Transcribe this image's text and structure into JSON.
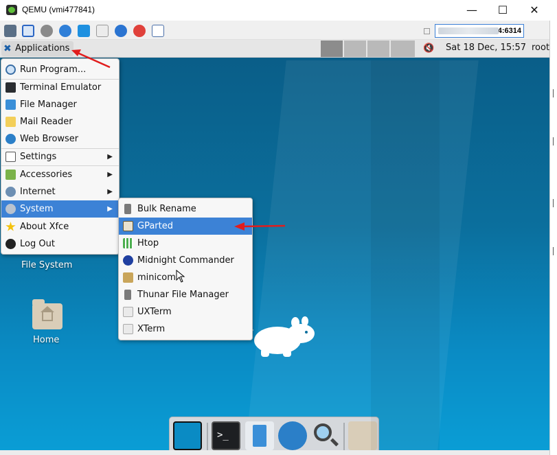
{
  "window": {
    "title": "QEMU (vmi477841)",
    "minimize": "—",
    "maximize": "☐",
    "close": "✕"
  },
  "toolbar": {
    "icons": [
      "settings-icon",
      "fullscreen-icon",
      "gear-icon",
      "refresh-icon",
      "windows-icon",
      "keyboard-icon",
      "info-icon",
      "close-icon",
      "screenshot-icon"
    ],
    "address_suffix": "4:6314"
  },
  "panel": {
    "applications_label": "Applications",
    "clock": "Sat 18 Dec, 15:57",
    "user": "root",
    "volume_icon": "speaker-muted-icon"
  },
  "menu": {
    "items": [
      {
        "label": "Run Program...",
        "icon": "search-icon"
      },
      {
        "label": "Terminal Emulator",
        "icon": "terminal-icon"
      },
      {
        "label": "File Manager",
        "icon": "file-manager-icon"
      },
      {
        "label": "Mail Reader",
        "icon": "mail-icon"
      },
      {
        "label": "Web Browser",
        "icon": "globe-icon"
      },
      {
        "label": "Settings",
        "icon": "settings-icon",
        "submenu": true
      },
      {
        "label": "Accessories",
        "icon": "accessories-icon",
        "submenu": true
      },
      {
        "label": "Internet",
        "icon": "globe-icon",
        "submenu": true
      },
      {
        "label": "System",
        "icon": "gear-icon",
        "submenu": true,
        "highlighted": true
      },
      {
        "label": "About Xfce",
        "icon": "star-icon"
      },
      {
        "label": "Log Out",
        "icon": "logout-icon"
      }
    ]
  },
  "submenu": {
    "items": [
      {
        "label": "Bulk Rename",
        "icon": "hammer-icon"
      },
      {
        "label": "GParted",
        "icon": "gparted-icon",
        "highlighted": true
      },
      {
        "label": "Htop",
        "icon": "htop-icon"
      },
      {
        "label": "Midnight Commander",
        "icon": "mc-icon"
      },
      {
        "label": "minicom",
        "icon": "minicom-icon"
      },
      {
        "label": "Thunar File Manager",
        "icon": "hammer-icon"
      },
      {
        "label": "UXTerm",
        "icon": "xterm-icon"
      },
      {
        "label": "XTerm",
        "icon": "xterm-icon"
      }
    ]
  },
  "desktop": {
    "icons": [
      {
        "label": "File System"
      },
      {
        "label": "Home"
      }
    ]
  },
  "dock": {
    "items": [
      "show-desktop-icon",
      "terminal-icon",
      "file-manager-icon",
      "web-browser-icon",
      "search-icon",
      "folder-icon"
    ]
  },
  "colors": {
    "accent": "#3c82d6",
    "annotation_arrow": "#e11d1d",
    "desktop": "#0b6f9d"
  }
}
